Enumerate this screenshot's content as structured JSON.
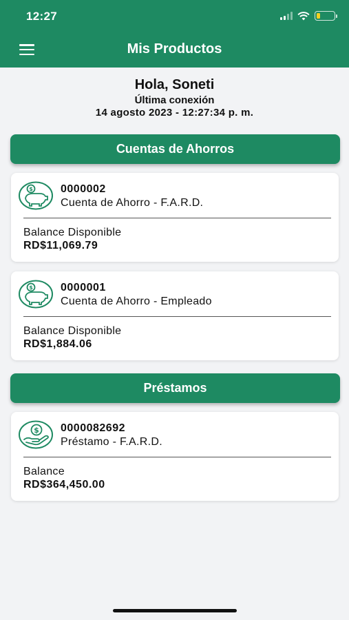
{
  "status_bar": {
    "time": "12:27"
  },
  "header": {
    "title": "Mis Productos",
    "menu_icon": "hamburger-menu-icon"
  },
  "greeting": {
    "hello": "Hola, Soneti",
    "last_login_label": "Última conexión",
    "last_login_datetime": "14 agosto 2023 - 12:27:34 p. m."
  },
  "savings": {
    "title": "Cuentas de Ahorros",
    "accounts": [
      {
        "number": "0000002",
        "name": "Cuenta de Ahorro - F.A.R.D.",
        "balance_label": "Balance Disponible",
        "balance": "RD$11,069.79",
        "icon": "piggy-bank-icon"
      },
      {
        "number": "0000001",
        "name": "Cuenta de Ahorro - Empleado",
        "balance_label": "Balance Disponible",
        "balance": "RD$1,884.06",
        "icon": "piggy-bank-icon"
      }
    ]
  },
  "loans": {
    "title": "Préstamos",
    "items": [
      {
        "number": "0000082692",
        "name": "Préstamo - F.A.R.D.",
        "balance_label": "Balance",
        "balance": "RD$364,450.00",
        "icon": "hand-coin-icon"
      }
    ]
  },
  "colors": {
    "brand_green": "#1e8a62",
    "background": "#f2f3f5",
    "battery_yellow": "#f5d020"
  }
}
